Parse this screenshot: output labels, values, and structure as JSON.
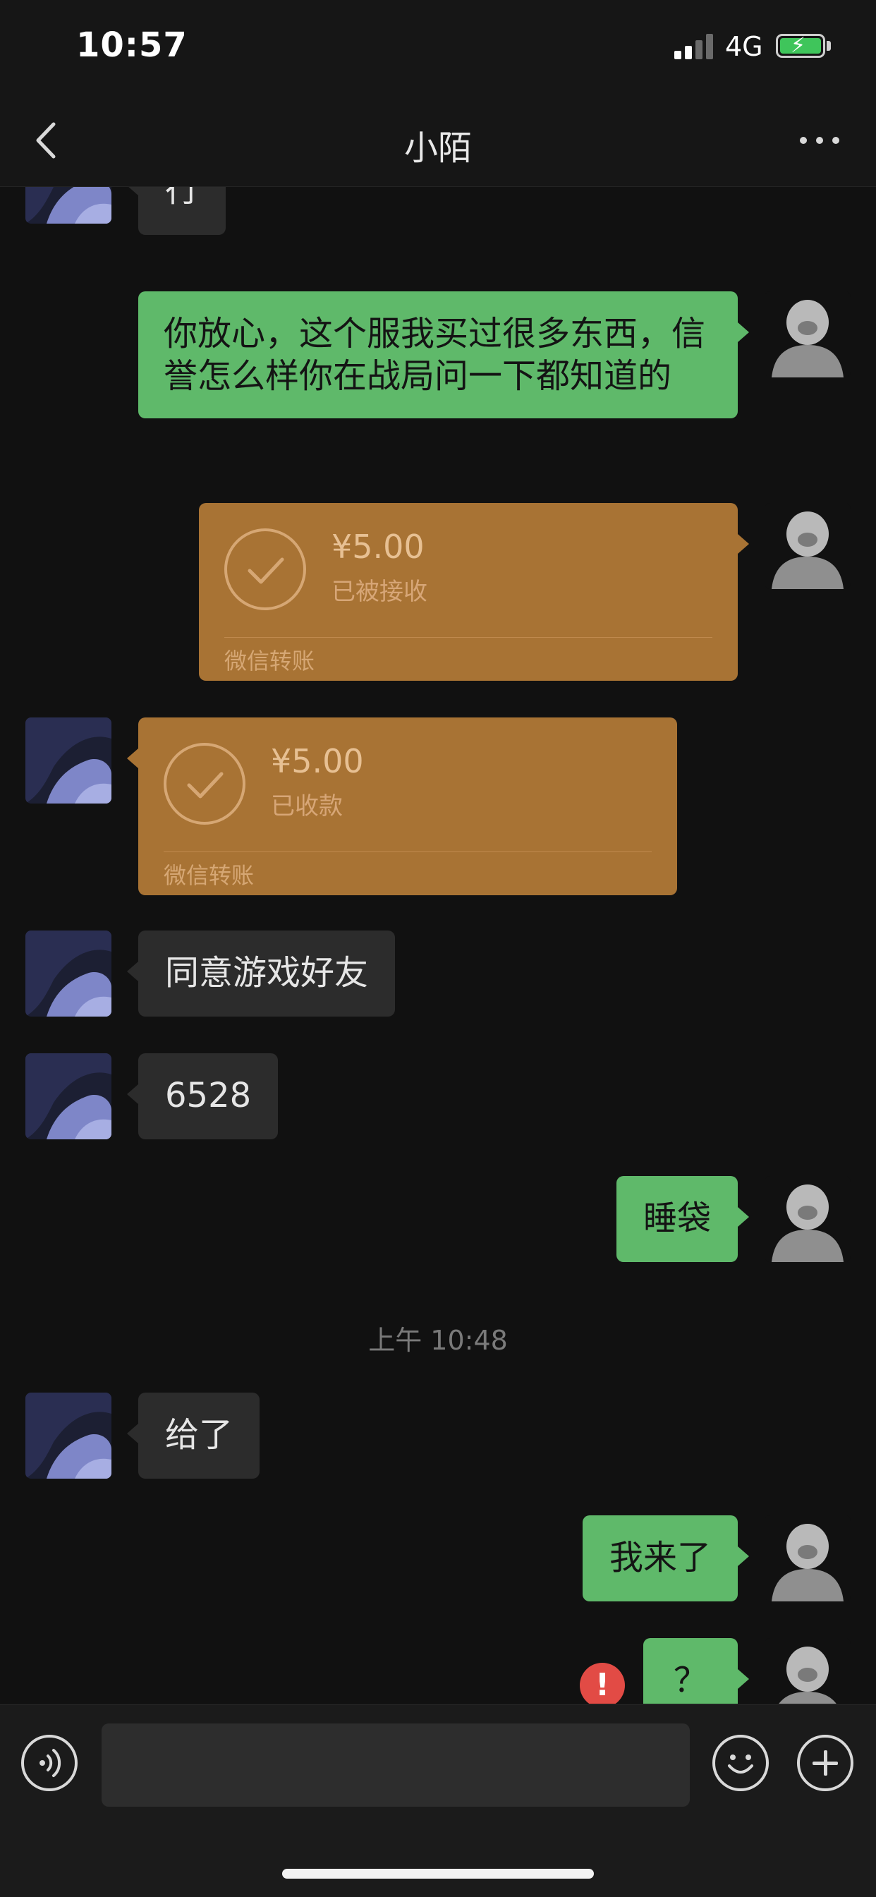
{
  "status_bar": {
    "time": "10:57",
    "network": "4G"
  },
  "nav": {
    "title": "小陌"
  },
  "messages": [
    {
      "from": "contact",
      "text": "行"
    },
    {
      "from": "me",
      "text": "你放心，这个服我买过很多东西，信誉怎么样你在战局问一下都知道的"
    },
    {
      "from": "me",
      "type": "transfer",
      "amount": "¥5.00",
      "status": "已被接收",
      "footer": "微信转账"
    },
    {
      "from": "contact",
      "type": "transfer",
      "amount": "¥5.00",
      "status": "已收款",
      "footer": "微信转账"
    },
    {
      "from": "contact",
      "text": "同意游戏好友"
    },
    {
      "from": "contact",
      "text": "6528"
    },
    {
      "from": "me",
      "text": "睡袋"
    },
    {
      "type": "timestamp",
      "text": "上午 10:48"
    },
    {
      "from": "contact",
      "text": "给了"
    },
    {
      "from": "me",
      "text": "我来了"
    },
    {
      "from": "me",
      "text": "？",
      "failed": true,
      "error_mark": "!"
    }
  ],
  "input_bar": {
    "text": ""
  },
  "colors": {
    "background": "#111111",
    "sent_bubble": "#5fb96a",
    "received_bubble": "#2c2c2c",
    "transfer_bubble": "#a87334",
    "error": "#e24b45"
  },
  "icons": {
    "back": "chevron-left-icon",
    "more": "more-dots-icon",
    "voice": "voice-icon",
    "emoji": "emoji-icon",
    "plus": "plus-icon",
    "check": "check-circle-icon",
    "error": "error-icon"
  }
}
